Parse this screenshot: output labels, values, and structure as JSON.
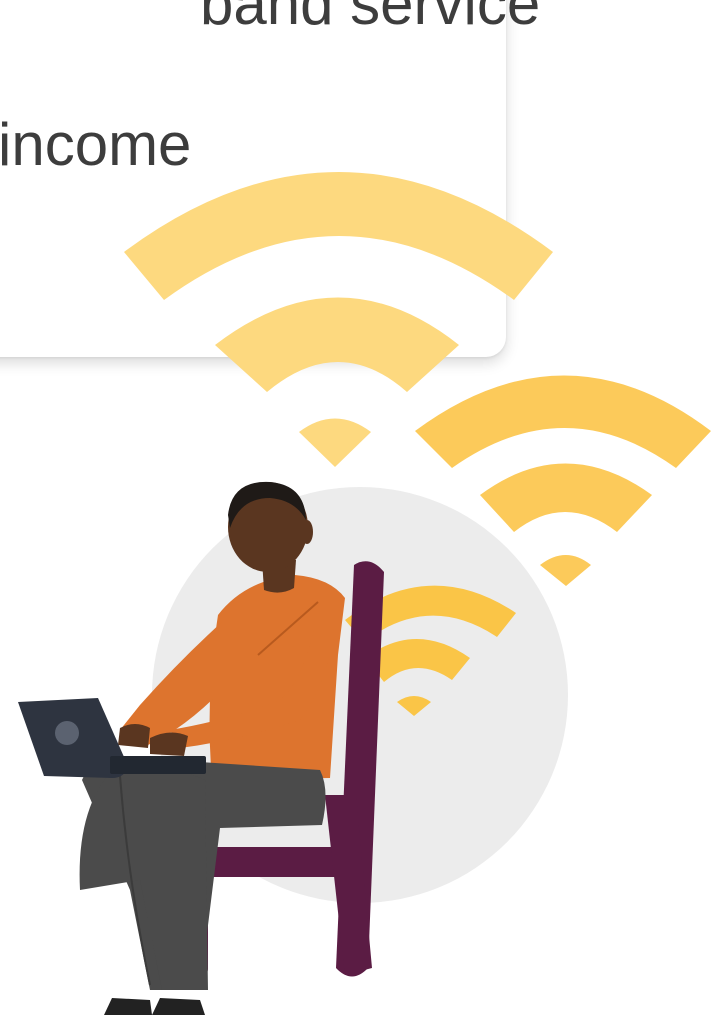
{
  "card": {
    "line_1": "band service",
    "line_2": "income"
  },
  "illustration": {
    "colors": {
      "wifi_light": "#fdd97f",
      "wifi_medium": "#fcca5a",
      "wifi_small": "#fac547",
      "circle": "#ececec",
      "skin": "#5a3620",
      "hair": "#1f1a17",
      "shirt": "#dd742e",
      "pants": "#4b4b4b",
      "chair": "#5b1c44",
      "laptop": "#2e3440"
    },
    "icons": [
      "wifi-icon",
      "wifi-icon",
      "wifi-icon"
    ]
  }
}
